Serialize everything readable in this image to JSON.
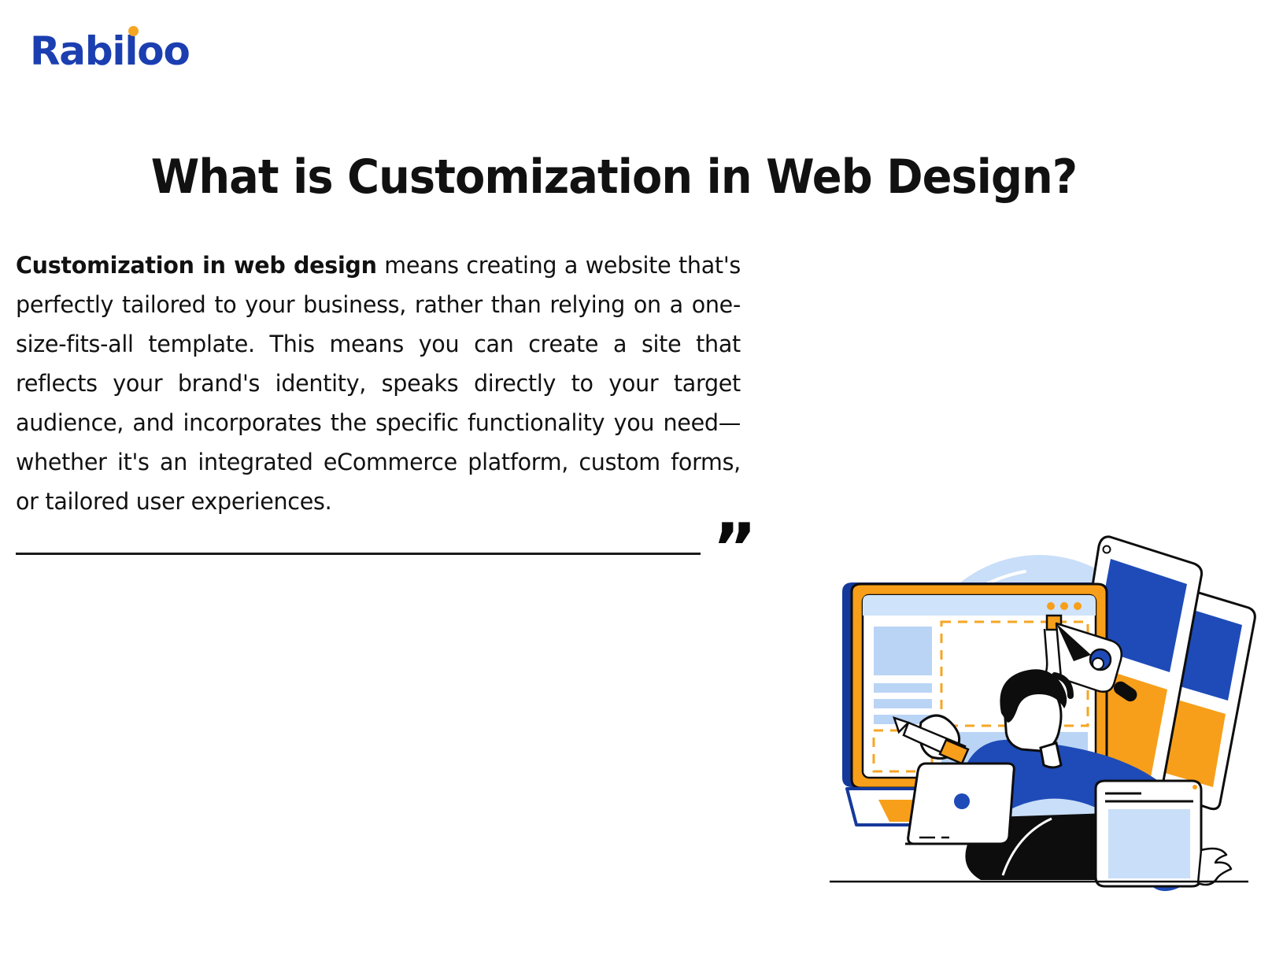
{
  "brand": {
    "logo_text": "Rabiloo",
    "logo_color": "#1b3fb0",
    "accent_color": "#f5a623"
  },
  "header": {
    "title": "What is Customization in Web Design?"
  },
  "quote": {
    "lead": "Customization in web design",
    "body": " means creating a website that's perfectly tailored to your business, rather than relying on a one-size-fits-all template. This means you can create a site that reflects your brand's identity, speaks directly to your target audience, and incorporates the specific functionality you need—whether it's an integrated eCommerce platform, custom forms, or tailored user experiences.",
    "quote_mark": "”"
  },
  "illustration": {
    "name": "web-design-workspace-illustration",
    "colors": {
      "blue": "#1e4bb8",
      "deep_blue": "#15399b",
      "orange": "#f79f1a",
      "light_blue": "#b9d4f5",
      "pale_blue": "#d7e7fb",
      "black": "#0d0d0d",
      "white": "#ffffff"
    },
    "elements": [
      "background-blob",
      "monitor",
      "tablet-stack",
      "pen-tool",
      "person",
      "laptop",
      "tablet-front",
      "ground-line"
    ]
  }
}
